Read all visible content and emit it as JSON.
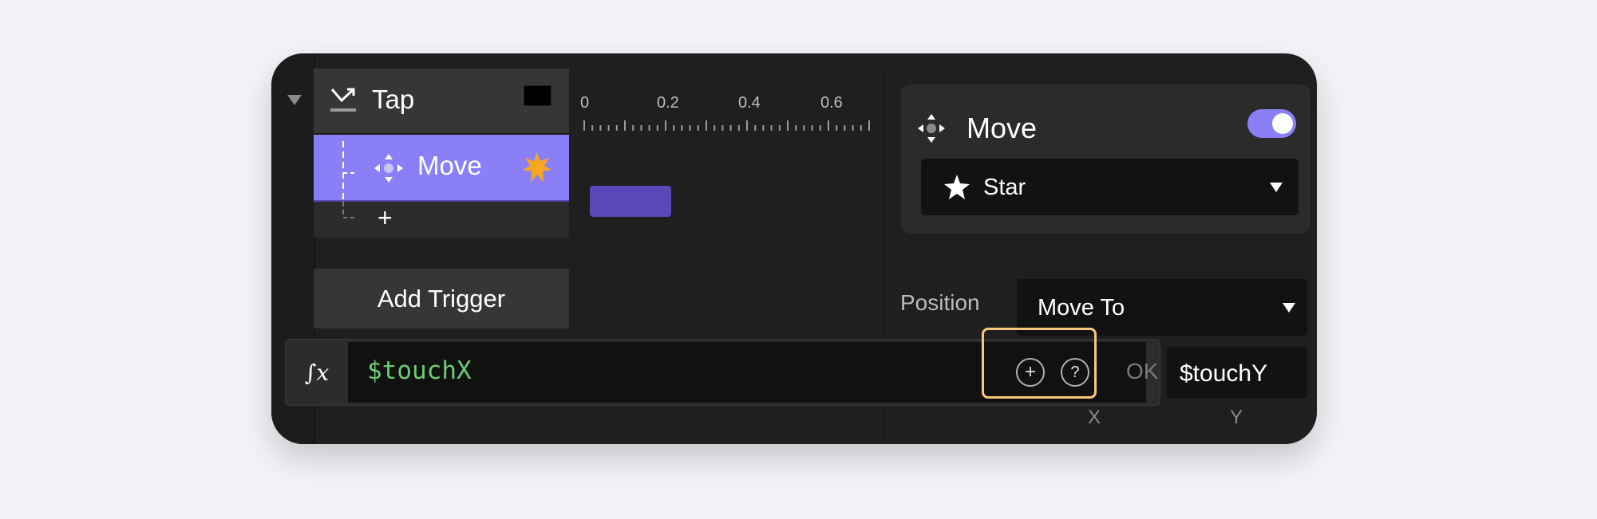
{
  "triggers": {
    "collapse_icon": "triangle-down-icon",
    "tap": {
      "label": "Tap",
      "icon": "tap-gesture-icon",
      "color_swatch": "#000000"
    },
    "move": {
      "label": "Move",
      "icon": "move-arrows-icon",
      "badge_icon": "starburst-icon",
      "badge_color": "#f5a623"
    },
    "add_action_icon": "plus-icon",
    "add_trigger_label": "Add Trigger"
  },
  "timeline": {
    "ticks": [
      "0",
      "0.2",
      "0.4",
      "0.6"
    ],
    "bar_color": "#5b47b8",
    "bar_start": 0,
    "bar_end": 0.2
  },
  "inspector": {
    "title": "Move",
    "enabled": true,
    "accent": "#8b7ff8",
    "target": {
      "label": "Star",
      "icon": "star-icon"
    },
    "position_label": "Position",
    "position_mode": "Move To",
    "y_value": "$touchY",
    "x_axis_label": "X",
    "y_axis_label": "Y"
  },
  "formula": {
    "fx_label": "∫x",
    "value": "$touchX",
    "ok_label": "OK",
    "highlight_color": "#f9c77a"
  }
}
